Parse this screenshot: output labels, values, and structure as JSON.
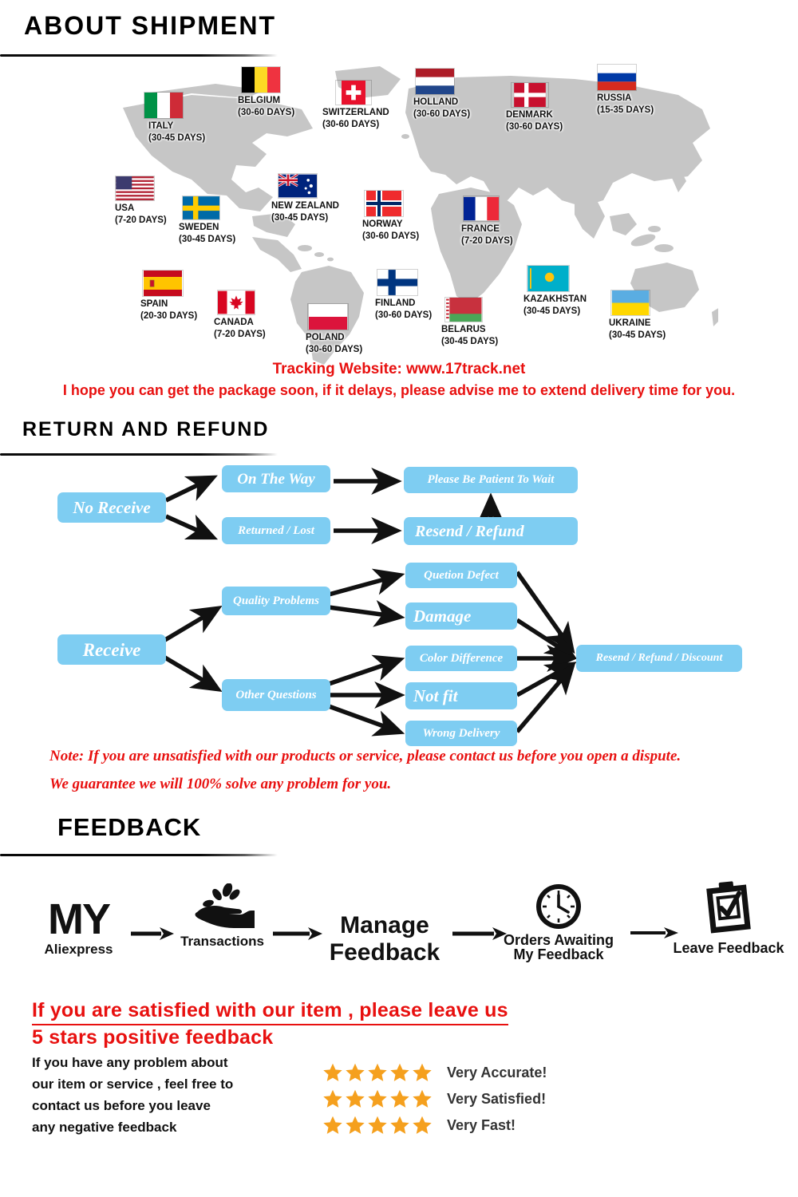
{
  "sections": {
    "shipment": {
      "title": "ABOUT  SHIPMENT"
    },
    "return": {
      "title": "RETURN  AND  REFUND"
    },
    "feedback": {
      "title": "FEEDBACK"
    }
  },
  "shipment": {
    "countries": [
      {
        "name": "ITALY",
        "days": "(30-45 DAYS)",
        "flag": "italy"
      },
      {
        "name": "BELGIUM",
        "days": "(30-60 DAYS)",
        "flag": "belgium"
      },
      {
        "name": "SWITZERLAND",
        "days": "(30-60 DAYS)",
        "flag": "switzerland"
      },
      {
        "name": "HOLLAND",
        "days": "(30-60 DAYS)",
        "flag": "holland"
      },
      {
        "name": "DENMARK",
        "days": "(30-60 DAYS)",
        "flag": "denmark"
      },
      {
        "name": "RUSSIA",
        "days": "(15-35 DAYS)",
        "flag": "russia"
      },
      {
        "name": "USA",
        "days": "(7-20 DAYS)",
        "flag": "usa"
      },
      {
        "name": "SWEDEN",
        "days": "(30-45 DAYS)",
        "flag": "sweden"
      },
      {
        "name": "NEW ZEALAND",
        "days": "(30-45 DAYS)",
        "flag": "new-zealand"
      },
      {
        "name": "NORWAY",
        "days": "(30-60 DAYS)",
        "flag": "norway"
      },
      {
        "name": "FRANCE",
        "days": "(7-20 DAYS)",
        "flag": "france"
      },
      {
        "name": "SPAIN",
        "days": "(20-30 DAYS)",
        "flag": "spain"
      },
      {
        "name": "CANADA",
        "days": "(7-20 DAYS)",
        "flag": "canada"
      },
      {
        "name": "POLAND",
        "days": "(30-60 DAYS)",
        "flag": "poland"
      },
      {
        "name": "FINLAND",
        "days": "(30-60 DAYS)",
        "flag": "finland"
      },
      {
        "name": "BELARUS",
        "days": "(30-45 DAYS)",
        "flag": "belarus"
      },
      {
        "name": "KAZAKHSTAN",
        "days": "(30-45 DAYS)",
        "flag": "kazakhstan"
      },
      {
        "name": "UKRAINE",
        "days": "(30-45 DAYS)",
        "flag": "ukraine"
      }
    ],
    "tracking_line": "Tracking Website: www.17track.net",
    "hope_line": "I hope you can get the package soon, if it delays, please advise me to extend delivery time for you."
  },
  "flow": {
    "nodes": {
      "no_receive": "No Receive",
      "on_the_way": "On The Way",
      "returned_lost": "Returned / Lost",
      "please_wait": "Please Be Patient To Wait",
      "resend_refund": "Resend / Refund",
      "receive": "Receive",
      "quality_problems": "Quality Problems",
      "other_questions": "Other Questions",
      "quetion_defect": "Quetion Defect",
      "damage": "Damage",
      "color_difference": "Color Difference",
      "not_fit": "Not fit",
      "wrong_delivery": "Wrong Delivery",
      "resend_refund_discount": "Resend / Refund / Discount"
    },
    "note_line1": "Note: If you are unsatisfied with our products or service, please contact us before you open a dispute.",
    "note_line2": "We guarantee we will 100% solve any problem for you."
  },
  "feedback": {
    "steps": [
      {
        "icon": "my-aliexpress-icon",
        "title": "MY",
        "label": "Aliexpress"
      },
      {
        "icon": "hand-coins-icon",
        "title": "",
        "label": "Transactions"
      },
      {
        "icon": "manage-feedback-text-icon",
        "title": "Manage",
        "label": "Feedback"
      },
      {
        "icon": "clock-icon",
        "title": "",
        "label": "Orders Awaiting\nMy Feedback"
      },
      {
        "icon": "clipboard-check-icon",
        "title": "",
        "label": "Leave Feedback"
      }
    ],
    "red_line1": "If you are satisfied with our item , please leave us",
    "red_line2": "5 stars positive feedback",
    "black_paragraph": "If you have any problem about\nour item or service , feel free to\ncontact us before you  leave\nany negative feedback",
    "ratings": [
      {
        "stars": 5,
        "text": "Very Accurate!"
      },
      {
        "stars": 5,
        "text": "Very Satisfied!"
      },
      {
        "stars": 5,
        "text": "Very Fast!"
      }
    ]
  },
  "colors": {
    "red": "#e8100f",
    "node_blue": "#7ecdf2",
    "star_orange": "#F5A01E",
    "map_gray": "#c6c6c6"
  }
}
